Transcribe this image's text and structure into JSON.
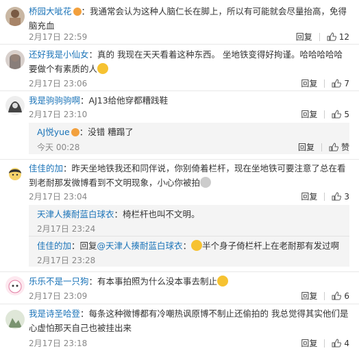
{
  "reply_label": "回复",
  "sub_like_label": "赞",
  "comments": [
    {
      "user": "桥园大呲花",
      "text": "我通常会认为这种人脑仁长在脚上，所以有可能就会尽量抬高，免得脑充血",
      "time": "2月17日 22:59",
      "likes": "12"
    },
    {
      "user": "还好我是小仙女",
      "text": "真的 我现在天天看着这种东西。 坐地铁变得好拘谨。哈哈哈哈哈 要做个有素质的人",
      "time": "2月17日 23:06",
      "likes": "7"
    },
    {
      "user": "我是驹驹驹啊",
      "text": "AJ13给他穿都糟践鞋",
      "time": "2月17日 23:10",
      "likes": "5"
    },
    {
      "user": "佳佳的加",
      "text": "昨天坐地铁我还和同伴说，你别倚着栏杆，现在坐地铁可要注意了总在看到老耐那发微博看到不文明现象，小心你被拍",
      "time": "2月17日 23:04",
      "likes": "3"
    },
    {
      "user": "乐乐不是一只狗",
      "text": "有本事拍照为什么没本事去制止",
      "time": "2月17日 23:09",
      "likes": "6"
    },
    {
      "user": "我是诗圣哈登",
      "text": "每条这种微博都有冷嘲热讽原博不制止还偷拍的 我总觉得其实他们是心虚怕那天自己也被挂出来",
      "time": "2月17日 23:18",
      "likes": "4"
    }
  ],
  "subreplies": [
    {
      "user": "AJ悦yue",
      "text": "没错 糟蹋了",
      "time": "今天 00:28"
    },
    {
      "user": "天津人揍耐蓝白球衣",
      "text": "椅栏杆也叫不文明。",
      "time": "2月17日 23:24"
    },
    {
      "user": "佳佳的加",
      "reply_prefix": "回复",
      "mention": "@天津人揍耐蓝白球衣",
      "text": "半个身子倚栏杆上在老耐那有发过啊",
      "time": "2月17日 23:28"
    }
  ],
  "colors": {
    "username": "#1a73b8",
    "meta": "#888888",
    "subbox": "#f4f4f4"
  }
}
